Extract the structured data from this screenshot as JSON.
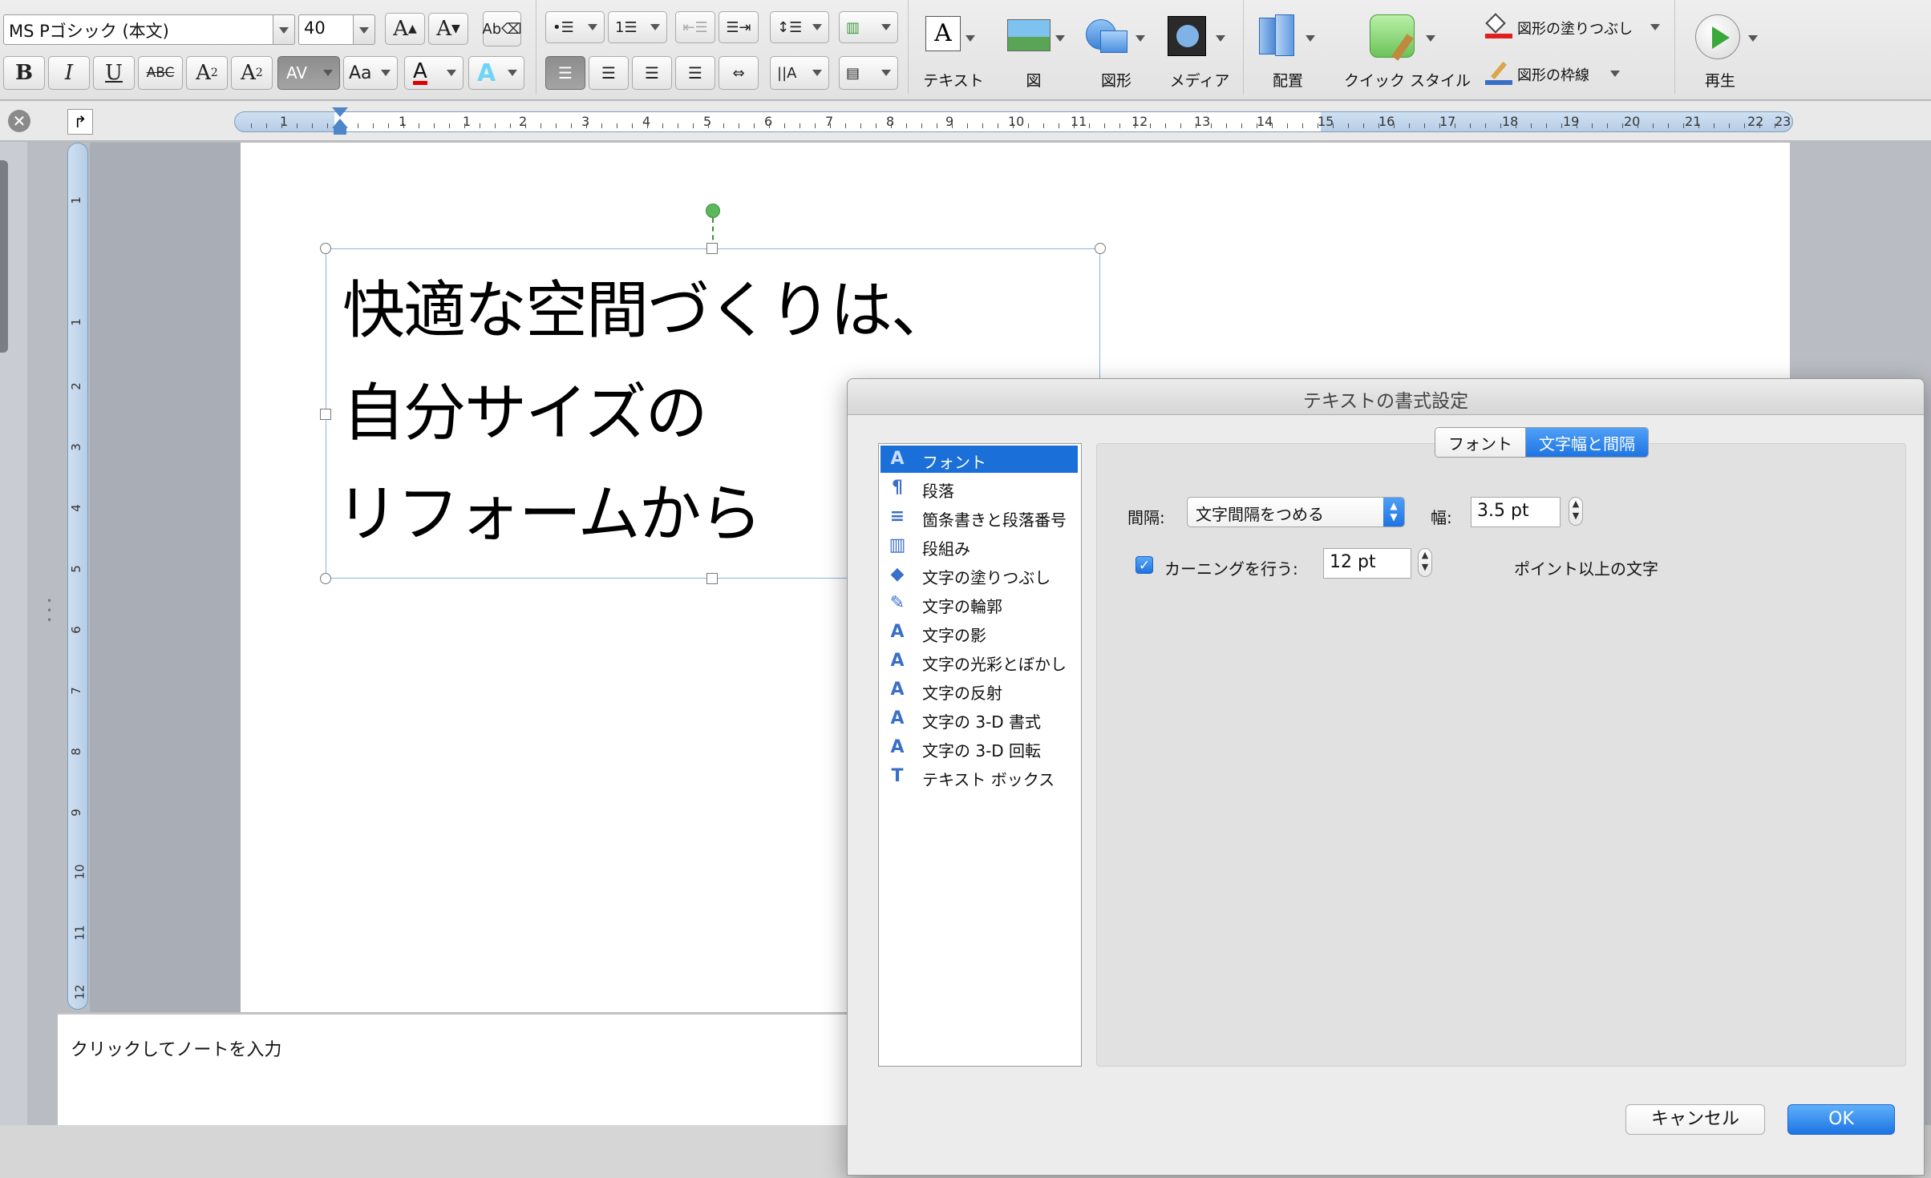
{
  "ribbon": {
    "font_name": "MS Pゴシック (本文)",
    "font_size": "40",
    "grow_font_label": "A",
    "shrink_font_label": "A",
    "bold_label": "B",
    "italic_label": "I",
    "underline_label": "U",
    "strike_label": "ABC",
    "superscript_label": "A",
    "subscript_label": "A",
    "spacing_label": "AV",
    "change_case_label": "Aa",
    "font_color_label": "A",
    "text_effect_label": "A",
    "text_btn": "テキスト",
    "picture_btn": "図",
    "shape_btn": "図形",
    "media_btn": "メディア",
    "arrange_btn": "配置",
    "quick_style_btn": "クイック スタイル",
    "shape_fill": "図形の塗りつぶし",
    "shape_outline": "図形の枠線",
    "play_btn": "再生"
  },
  "ruler": {
    "h_numbers": [
      "1",
      "1",
      "1",
      "2",
      "3",
      "4",
      "5",
      "6",
      "7",
      "8",
      "9",
      "10",
      "11",
      "12",
      "13",
      "14",
      "15",
      "16",
      "17",
      "18",
      "19",
      "20",
      "21",
      "22",
      "23"
    ],
    "v_numbers": [
      "1",
      "1",
      "2",
      "3",
      "4",
      "5",
      "6",
      "7",
      "8",
      "9",
      "10",
      "11",
      "12"
    ]
  },
  "slide": {
    "line1": "快適な空間づくりは、",
    "line2": "自分サイズの",
    "line3": "リフォームから"
  },
  "notes": {
    "placeholder": "クリックしてノートを入力"
  },
  "dialog": {
    "title": "テキストの書式設定",
    "categories": [
      {
        "icon": "A",
        "label": "フォント"
      },
      {
        "icon": "¶",
        "label": "段落"
      },
      {
        "icon": "≡",
        "label": "箇条書きと段落番号"
      },
      {
        "icon": "▥",
        "label": "段組み"
      },
      {
        "icon": "◆",
        "label": "文字の塗りつぶし"
      },
      {
        "icon": "✎",
        "label": "文字の輪郭"
      },
      {
        "icon": "A",
        "label": "文字の影"
      },
      {
        "icon": "A",
        "label": "文字の光彩とぼかし"
      },
      {
        "icon": "A",
        "label": "文字の反射"
      },
      {
        "icon": "A",
        "label": "文字の 3-D 書式"
      },
      {
        "icon": "A",
        "label": "文字の 3-D 回転"
      },
      {
        "icon": "T",
        "label": "テキスト ボックス"
      }
    ],
    "tabs": [
      "フォント",
      "文字幅と間隔"
    ],
    "spacing_label": "間隔:",
    "spacing_value": "文字間隔をつめる",
    "width_label": "幅:",
    "width_value": "3.5 pt",
    "kerning_label": "カーニングを行う:",
    "kerning_value": "12 pt",
    "kerning_suffix": "ポイント以上の文字",
    "cancel": "キャンセル",
    "ok": "OK"
  },
  "colors": {
    "selection_blue": "#1a6fd8",
    "font_color_red": "#e00000",
    "play_green": "#3aa83a"
  }
}
